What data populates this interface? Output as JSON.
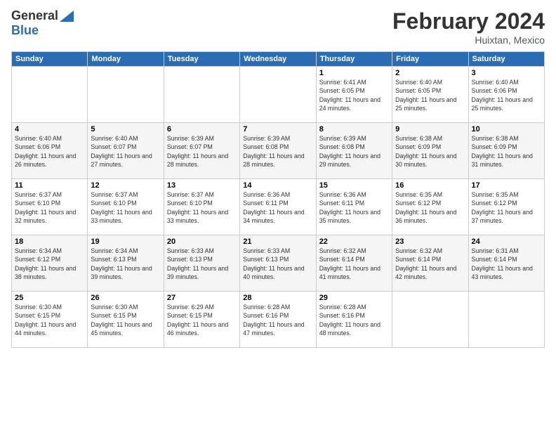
{
  "app": {
    "logo_general": "General",
    "logo_blue": "Blue",
    "month_title": "February 2024",
    "location": "Huixtan, Mexico"
  },
  "calendar": {
    "headers": [
      "Sunday",
      "Monday",
      "Tuesday",
      "Wednesday",
      "Thursday",
      "Friday",
      "Saturday"
    ],
    "weeks": [
      [
        {
          "day": "",
          "info": ""
        },
        {
          "day": "",
          "info": ""
        },
        {
          "day": "",
          "info": ""
        },
        {
          "day": "",
          "info": ""
        },
        {
          "day": "1",
          "info": "Sunrise: 6:41 AM\nSunset: 6:05 PM\nDaylight: 11 hours and 24 minutes."
        },
        {
          "day": "2",
          "info": "Sunrise: 6:40 AM\nSunset: 6:05 PM\nDaylight: 11 hours and 25 minutes."
        },
        {
          "day": "3",
          "info": "Sunrise: 6:40 AM\nSunset: 6:06 PM\nDaylight: 11 hours and 25 minutes."
        }
      ],
      [
        {
          "day": "4",
          "info": "Sunrise: 6:40 AM\nSunset: 6:06 PM\nDaylight: 11 hours and 26 minutes."
        },
        {
          "day": "5",
          "info": "Sunrise: 6:40 AM\nSunset: 6:07 PM\nDaylight: 11 hours and 27 minutes."
        },
        {
          "day": "6",
          "info": "Sunrise: 6:39 AM\nSunset: 6:07 PM\nDaylight: 11 hours and 28 minutes."
        },
        {
          "day": "7",
          "info": "Sunrise: 6:39 AM\nSunset: 6:08 PM\nDaylight: 11 hours and 28 minutes."
        },
        {
          "day": "8",
          "info": "Sunrise: 6:39 AM\nSunset: 6:08 PM\nDaylight: 11 hours and 29 minutes."
        },
        {
          "day": "9",
          "info": "Sunrise: 6:38 AM\nSunset: 6:09 PM\nDaylight: 11 hours and 30 minutes."
        },
        {
          "day": "10",
          "info": "Sunrise: 6:38 AM\nSunset: 6:09 PM\nDaylight: 11 hours and 31 minutes."
        }
      ],
      [
        {
          "day": "11",
          "info": "Sunrise: 6:37 AM\nSunset: 6:10 PM\nDaylight: 11 hours and 32 minutes."
        },
        {
          "day": "12",
          "info": "Sunrise: 6:37 AM\nSunset: 6:10 PM\nDaylight: 11 hours and 33 minutes."
        },
        {
          "day": "13",
          "info": "Sunrise: 6:37 AM\nSunset: 6:10 PM\nDaylight: 11 hours and 33 minutes."
        },
        {
          "day": "14",
          "info": "Sunrise: 6:36 AM\nSunset: 6:11 PM\nDaylight: 11 hours and 34 minutes."
        },
        {
          "day": "15",
          "info": "Sunrise: 6:36 AM\nSunset: 6:11 PM\nDaylight: 11 hours and 35 minutes."
        },
        {
          "day": "16",
          "info": "Sunrise: 6:35 AM\nSunset: 6:12 PM\nDaylight: 11 hours and 36 minutes."
        },
        {
          "day": "17",
          "info": "Sunrise: 6:35 AM\nSunset: 6:12 PM\nDaylight: 11 hours and 37 minutes."
        }
      ],
      [
        {
          "day": "18",
          "info": "Sunrise: 6:34 AM\nSunset: 6:12 PM\nDaylight: 11 hours and 38 minutes."
        },
        {
          "day": "19",
          "info": "Sunrise: 6:34 AM\nSunset: 6:13 PM\nDaylight: 11 hours and 39 minutes."
        },
        {
          "day": "20",
          "info": "Sunrise: 6:33 AM\nSunset: 6:13 PM\nDaylight: 11 hours and 39 minutes."
        },
        {
          "day": "21",
          "info": "Sunrise: 6:33 AM\nSunset: 6:13 PM\nDaylight: 11 hours and 40 minutes."
        },
        {
          "day": "22",
          "info": "Sunrise: 6:32 AM\nSunset: 6:14 PM\nDaylight: 11 hours and 41 minutes."
        },
        {
          "day": "23",
          "info": "Sunrise: 6:32 AM\nSunset: 6:14 PM\nDaylight: 11 hours and 42 minutes."
        },
        {
          "day": "24",
          "info": "Sunrise: 6:31 AM\nSunset: 6:14 PM\nDaylight: 11 hours and 43 minutes."
        }
      ],
      [
        {
          "day": "25",
          "info": "Sunrise: 6:30 AM\nSunset: 6:15 PM\nDaylight: 11 hours and 44 minutes."
        },
        {
          "day": "26",
          "info": "Sunrise: 6:30 AM\nSunset: 6:15 PM\nDaylight: 11 hours and 45 minutes."
        },
        {
          "day": "27",
          "info": "Sunrise: 6:29 AM\nSunset: 6:15 PM\nDaylight: 11 hours and 46 minutes."
        },
        {
          "day": "28",
          "info": "Sunrise: 6:28 AM\nSunset: 6:16 PM\nDaylight: 11 hours and 47 minutes."
        },
        {
          "day": "29",
          "info": "Sunrise: 6:28 AM\nSunset: 6:16 PM\nDaylight: 11 hours and 48 minutes."
        },
        {
          "day": "",
          "info": ""
        },
        {
          "day": "",
          "info": ""
        }
      ]
    ]
  }
}
